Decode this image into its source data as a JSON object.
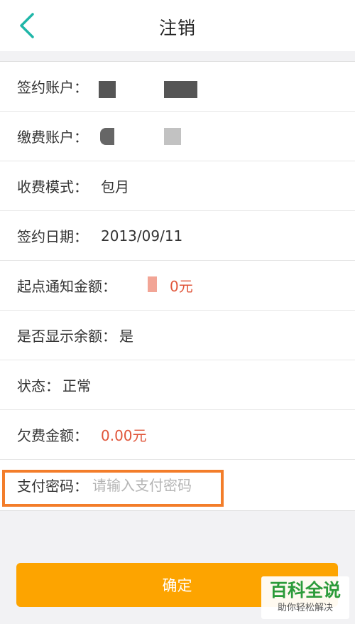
{
  "header": {
    "title": "注销",
    "back_icon": "chevron-left-icon",
    "accent": "#1fb6a8"
  },
  "fields": [
    {
      "label": "签约账户：",
      "value": ""
    },
    {
      "label": "缴费账户：",
      "value": ""
    },
    {
      "label": "收费模式：",
      "value": "包月"
    },
    {
      "label": "签约日期：",
      "value": "2013/09/11"
    },
    {
      "label": "起点通知金额：",
      "value": "0元"
    },
    {
      "label": "是否显示余额：",
      "value": "是"
    },
    {
      "label": "状态：",
      "value": "正常"
    },
    {
      "label": "欠费金额：",
      "value": "0.00元"
    }
  ],
  "password": {
    "label": "支付密码：",
    "placeholder": "请输入支付密码",
    "value": ""
  },
  "confirm_button": {
    "label": "确定",
    "color": "#fda400"
  },
  "watermark": {
    "main": "百科全说",
    "sub": "助你轻松解决"
  },
  "colors": {
    "value_red": "#e0553a",
    "highlight": "#f37d2a"
  }
}
